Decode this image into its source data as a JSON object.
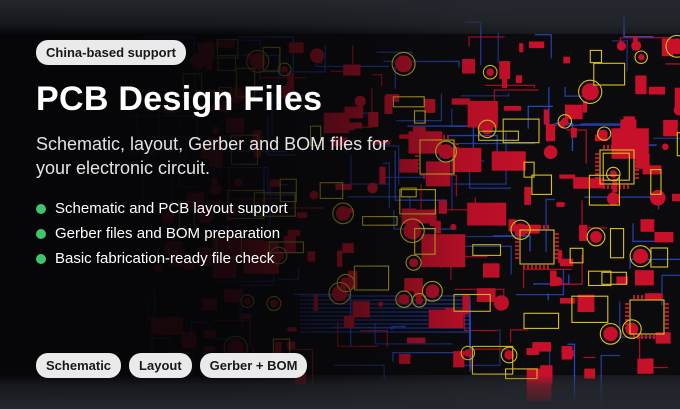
{
  "badge": "China-based support",
  "title": "PCB Design Files",
  "subtitle": "Schematic, layout, Gerber and BOM files for your electronic circuit.",
  "bullets": [
    "Schematic and PCB layout support",
    "Gerber files and BOM preparation",
    "Basic fabrication-ready file check"
  ],
  "tags": [
    "Schematic",
    "Layout",
    "Gerber + BOM"
  ],
  "colors": {
    "pill_background": "#eaeaea",
    "bullet_dot": "#3ec56e",
    "pcb_pad_red": "#c9102a",
    "pcb_trace_blue": "#2a4fd6",
    "pcb_silkscreen_yellow": "#d9c21f"
  }
}
